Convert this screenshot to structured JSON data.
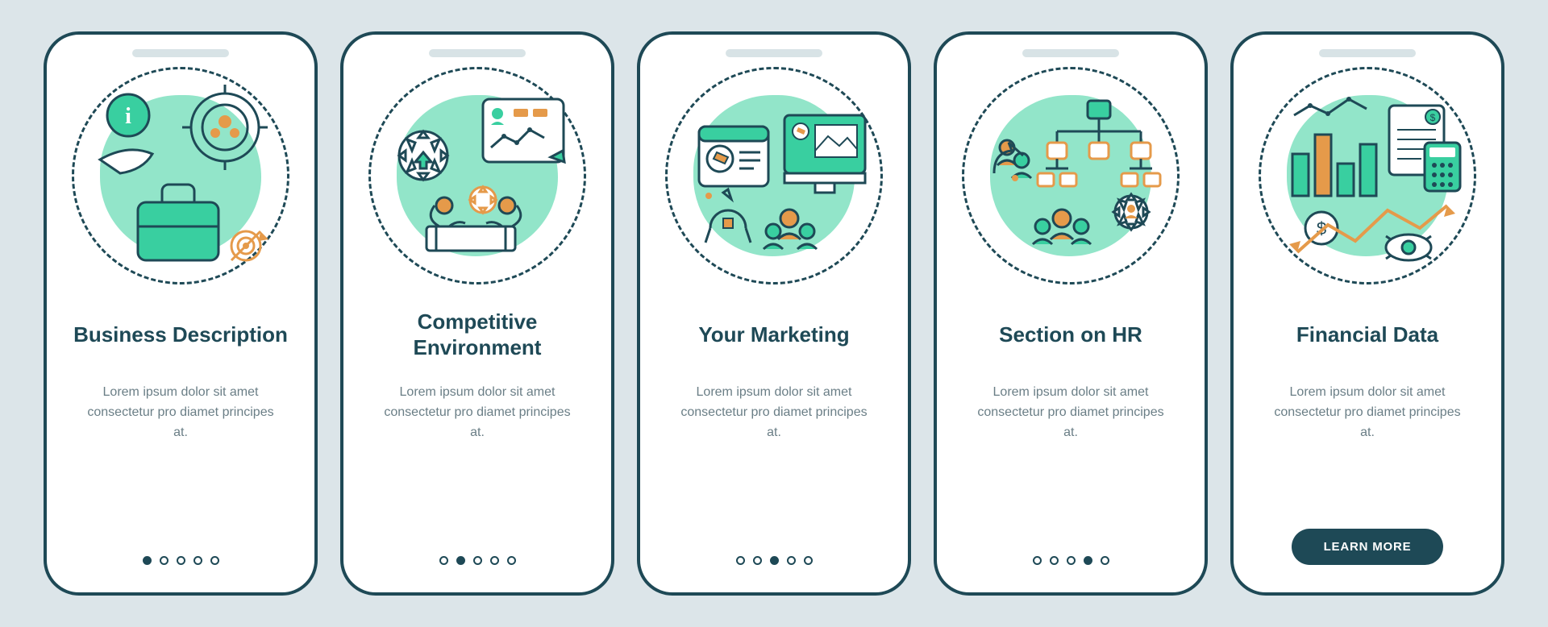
{
  "screens": [
    {
      "title": "Business Description",
      "desc": "Lorem ipsum dolor sit amet consectetur pro diamet principes at.",
      "activeDot": 0,
      "icon": "business"
    },
    {
      "title": "Competitive Environment",
      "desc": "Lorem ipsum dolor sit amet consectetur pro diamet principes at.",
      "activeDot": 1,
      "icon": "competitive"
    },
    {
      "title": "Your Marketing",
      "desc": "Lorem ipsum dolor sit amet consectetur pro diamet principes at.",
      "activeDot": 2,
      "icon": "marketing"
    },
    {
      "title": "Section on HR",
      "desc": "Lorem ipsum dolor sit amet consectetur pro diamet principes at.",
      "activeDot": 3,
      "icon": "hr"
    },
    {
      "title": "Financial Data",
      "desc": "Lorem ipsum dolor sit amet consectetur pro diamet principes at.",
      "cta": "LEARN MORE",
      "icon": "financial"
    }
  ],
  "dotCount": 5,
  "colors": {
    "stroke": "#1e4956",
    "accentGreen": "#39cfa0",
    "accentMint": "#7fe0bf",
    "accentOrange": "#e59a4a",
    "background": "#dce5e9"
  }
}
